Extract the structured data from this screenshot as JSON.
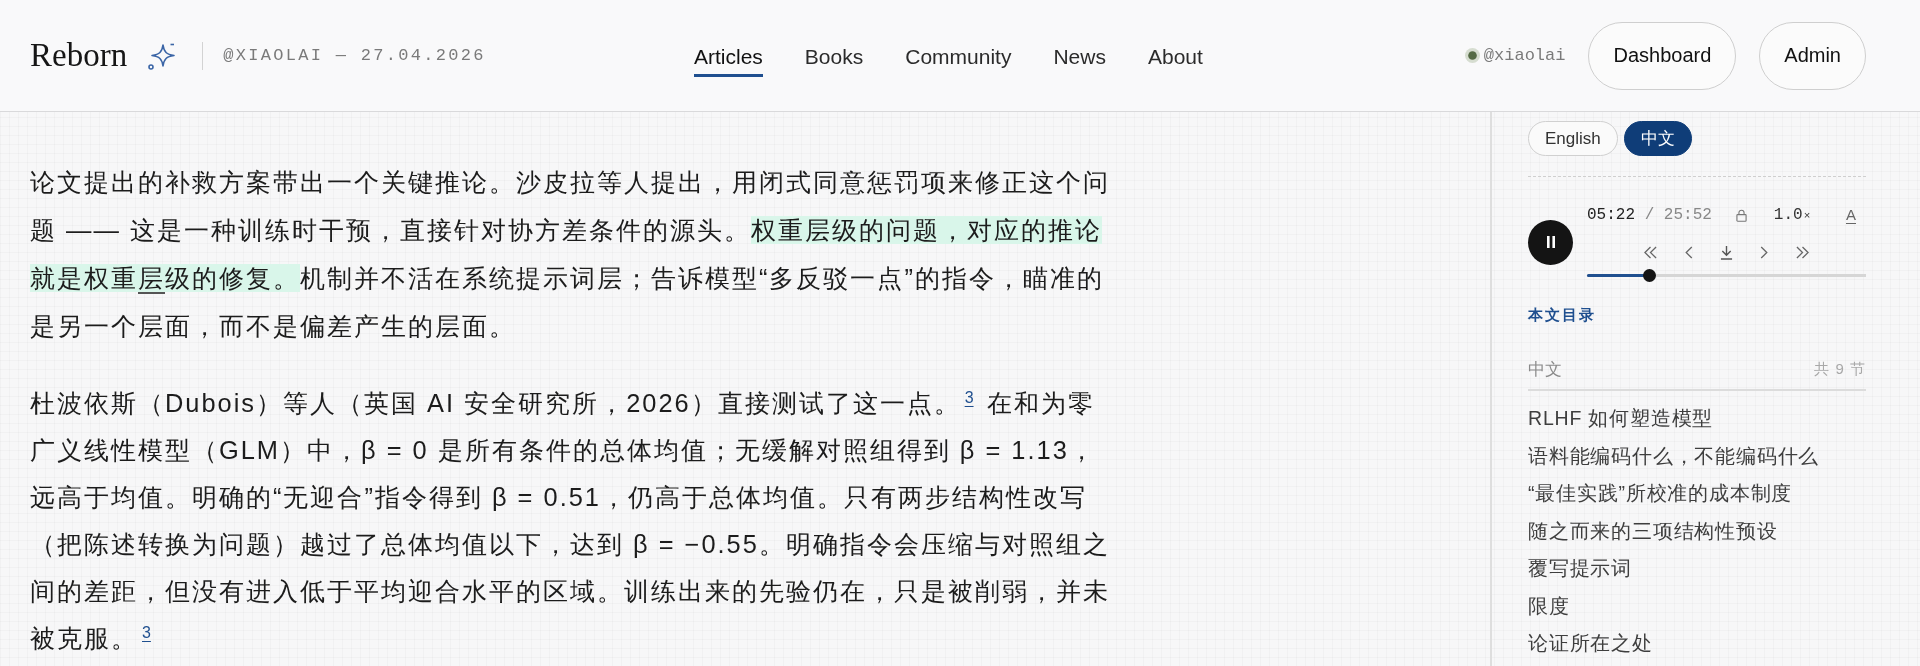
{
  "header": {
    "logo": "Reborn",
    "meta": "@XIAOLAI — 27.04.2026",
    "nav": [
      {
        "label": "Articles",
        "selected": true
      },
      {
        "label": "Books",
        "selected": false
      },
      {
        "label": "Community",
        "selected": false
      },
      {
        "label": "News",
        "selected": false
      },
      {
        "label": "About",
        "selected": false
      }
    ],
    "user": {
      "handle": "@xiaolai"
    },
    "buttons": [
      {
        "label": "Dashboard"
      },
      {
        "label": "Admin"
      }
    ]
  },
  "article": {
    "paragraphs": [
      {
        "segments": [
          {
            "kind": "plain",
            "underlined": false,
            "text": "论文提出的补救方案带出一个关键推论。沙皮拉等人提出，用闭式同意惩罚项来修正这个问题 —— 这是一种训练时干预，直接针对协方差条件的源头。"
          },
          {
            "kind": "highlight",
            "underlined": false,
            "text": "权重层级的问题，对应的推论就是权重"
          },
          {
            "kind": "highlight",
            "underlined": true,
            "text": "层"
          },
          {
            "kind": "highlight",
            "underlined": false,
            "text": "级的修复。"
          },
          {
            "kind": "plain",
            "underlined": false,
            "text": "机制并不活在系统提示词层；告诉模型“多反驳一点”的指令，瞄准的是另一个层面，而不是偏差产生的层面。"
          }
        ]
      },
      {
        "segments": [
          {
            "kind": "plain",
            "underlined": false,
            "text": "杜波依斯（Dubois）等人（英国 AI 安全研究所，2026）直接测试了这一点。"
          },
          {
            "kind": "footnote",
            "text": "3"
          },
          {
            "kind": "plain",
            "underlined": false,
            "text": " 在和为零广义线性模型（GLM）中，β = 0 是所有条件的总体均值；无缓解对照组得到 β = 1.13，远高于均值。明确的“无迎合”指令得到 β = 0.51，仍高于总体均值。只有两步结构性改写（把陈述转换为问题）越过了总体均值以下，达到 β = −0.55。明确指令会压缩与对照组之间的差距，但没有进入低于平均迎合水平的区域。训练出来的先验仍在，只是被削弱，并未被克服。"
          },
          {
            "kind": "footnote",
            "text": "3"
          }
        ]
      }
    ]
  },
  "sidebar": {
    "languages": [
      {
        "label": "English",
        "selected": false
      },
      {
        "label": "中文",
        "selected": true
      }
    ],
    "player": {
      "playing": true,
      "current": "05:22",
      "separator": "/",
      "total": "25:52",
      "speed": "1.0",
      "speed_unit": "×",
      "style_button": "A",
      "level": 0.21
    },
    "toc": {
      "title": "本文目录",
      "group": "中文",
      "count": "共 9 节",
      "items": [
        "RLHF 如何塑造模型",
        "语料能编码什么，不能编码什么",
        "“最佳实践”所校准的成本制度",
        "随之而来的三项结构性预设",
        "覆写提示词",
        "限度",
        "论证所在之处"
      ]
    }
  }
}
